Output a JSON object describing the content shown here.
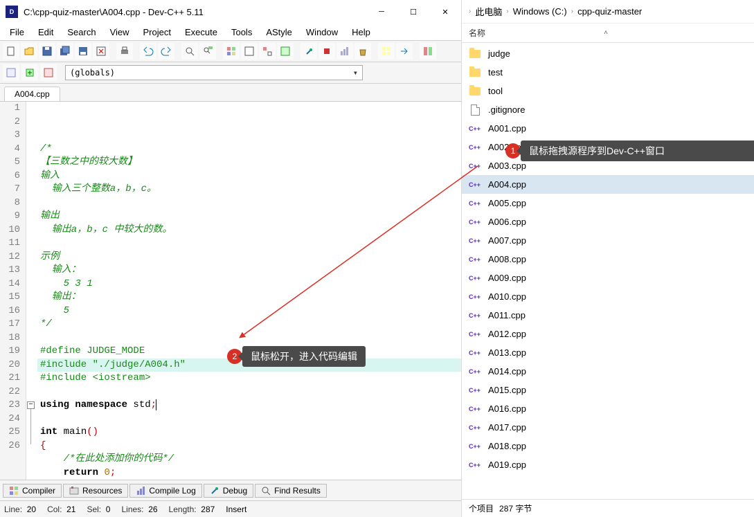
{
  "titlebar": {
    "title": "C:\\cpp-quiz-master\\A004.cpp - Dev-C++ 5.11"
  },
  "menu": [
    "File",
    "Edit",
    "Search",
    "View",
    "Project",
    "Execute",
    "Tools",
    "AStyle",
    "Window",
    "Help"
  ],
  "globals_combo": "(globals)",
  "tab": {
    "name": "A004.cpp"
  },
  "code": {
    "lines": [
      {
        "n": 1,
        "t": "comment",
        "s": "/*"
      },
      {
        "n": 2,
        "t": "comment",
        "s": "【三数之中的较大数】"
      },
      {
        "n": 3,
        "t": "comment",
        "s": "输入"
      },
      {
        "n": 4,
        "t": "comment",
        "s": "  输入三个整数a，b，c。"
      },
      {
        "n": 5,
        "t": "blank",
        "s": ""
      },
      {
        "n": 6,
        "t": "comment",
        "s": "输出"
      },
      {
        "n": 7,
        "t": "comment",
        "s": "  输出a，b，c 中较大的数。"
      },
      {
        "n": 8,
        "t": "blank",
        "s": ""
      },
      {
        "n": 9,
        "t": "comment",
        "s": "示例"
      },
      {
        "n": 10,
        "t": "comment",
        "s": "  输入："
      },
      {
        "n": 11,
        "t": "comment",
        "s": "    5 3 1"
      },
      {
        "n": 12,
        "t": "comment",
        "s": "  输出："
      },
      {
        "n": 13,
        "t": "comment",
        "s": "    5"
      },
      {
        "n": 14,
        "t": "comment",
        "s": "*/"
      },
      {
        "n": 15,
        "t": "blank",
        "s": ""
      },
      {
        "n": 16,
        "t": "pre",
        "s": "#define JUDGE_MODE"
      },
      {
        "n": 17,
        "t": "pre",
        "s": "#include \"./judge/A004.h\""
      },
      {
        "n": 18,
        "t": "pre",
        "s": "#include <iostream>"
      },
      {
        "n": 19,
        "t": "blank",
        "s": ""
      },
      {
        "n": 20,
        "t": "using",
        "s": "using namespace std;"
      },
      {
        "n": 21,
        "t": "blank",
        "s": ""
      },
      {
        "n": 22,
        "t": "main",
        "s": "int main()"
      },
      {
        "n": 23,
        "t": "brace",
        "s": "{"
      },
      {
        "n": 24,
        "t": "comment2",
        "s": "    /*在此处添加你的代码*/"
      },
      {
        "n": 25,
        "t": "return",
        "s": "    return 0;"
      },
      {
        "n": 26,
        "t": "brace",
        "s": "}"
      }
    ],
    "highlight_line": 20
  },
  "bottom_tabs": [
    {
      "label": "Compiler"
    },
    {
      "label": "Resources"
    },
    {
      "label": "Compile Log"
    },
    {
      "label": "Debug"
    },
    {
      "label": "Find Results"
    }
  ],
  "status": {
    "line_label": "Line:",
    "line": "20",
    "col_label": "Col:",
    "col": "21",
    "sel_label": "Sel:",
    "sel": "0",
    "lines_label": "Lines:",
    "lines": "26",
    "length_label": "Length:",
    "length": "287",
    "mode": "Insert"
  },
  "explorer": {
    "breadcrumb": [
      "此电脑",
      "Windows (C:)",
      "cpp-quiz-master"
    ],
    "col_name": "名称",
    "items": [
      {
        "type": "folder",
        "name": "judge"
      },
      {
        "type": "folder",
        "name": "test"
      },
      {
        "type": "folder",
        "name": "tool"
      },
      {
        "type": "file",
        "name": ".gitignore"
      },
      {
        "type": "cpp",
        "name": "A001.cpp"
      },
      {
        "type": "cpp",
        "name": "A002.cpp"
      },
      {
        "type": "cpp",
        "name": "A003.cpp"
      },
      {
        "type": "cpp",
        "name": "A004.cpp",
        "sel": true
      },
      {
        "type": "cpp",
        "name": "A005.cpp"
      },
      {
        "type": "cpp",
        "name": "A006.cpp"
      },
      {
        "type": "cpp",
        "name": "A007.cpp"
      },
      {
        "type": "cpp",
        "name": "A008.cpp"
      },
      {
        "type": "cpp",
        "name": "A009.cpp"
      },
      {
        "type": "cpp",
        "name": "A010.cpp"
      },
      {
        "type": "cpp",
        "name": "A011.cpp"
      },
      {
        "type": "cpp",
        "name": "A012.cpp"
      },
      {
        "type": "cpp",
        "name": "A013.cpp"
      },
      {
        "type": "cpp",
        "name": "A014.cpp"
      },
      {
        "type": "cpp",
        "name": "A015.cpp"
      },
      {
        "type": "cpp",
        "name": "A016.cpp"
      },
      {
        "type": "cpp",
        "name": "A017.cpp"
      },
      {
        "type": "cpp",
        "name": "A018.cpp"
      },
      {
        "type": "cpp",
        "name": "A019.cpp"
      }
    ],
    "status_items": "个项目",
    "status_bytes": "287 字节"
  },
  "annotations": {
    "a1": "鼠标拖拽源程序到Dev-C++窗口",
    "a2": "鼠标松开，进入代码编辑"
  }
}
